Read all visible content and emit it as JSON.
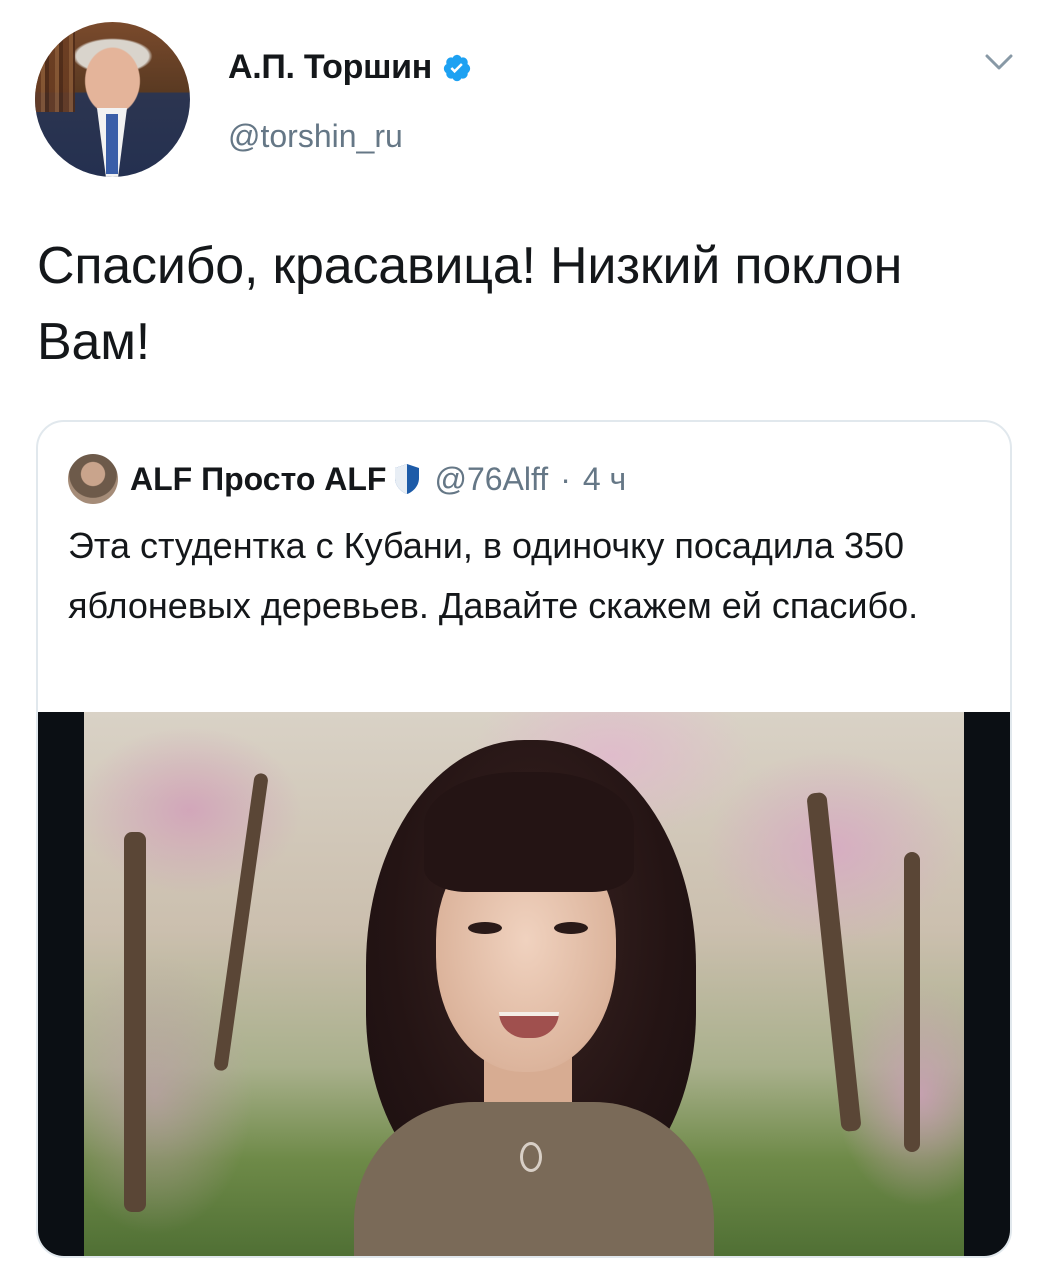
{
  "tweet": {
    "author_name": "А.П. Торшин",
    "handle": "@torshin_ru",
    "text": "Спасибо, красавица! Низкий поклон Вам!",
    "avatar_icon": "user-avatar",
    "verified_icon": "verified-badge-icon",
    "menu_icon": "chevron-down-icon"
  },
  "quoted": {
    "author_name": "ALF Просто ALF",
    "handle": "@76Alff",
    "separator": "·",
    "time": "4 ч",
    "text": "Эта студентка с Кубани, в одиночку посадила 350 яблоневых деревьев. Давайте скажем ей спасибо.",
    "shield_icon": "shield-icon",
    "photo_icon": "tweet-photo"
  },
  "colors": {
    "accent": "#1da1f2",
    "text": "#14171a",
    "secondary": "#657786",
    "border": "#e1e8ed"
  }
}
